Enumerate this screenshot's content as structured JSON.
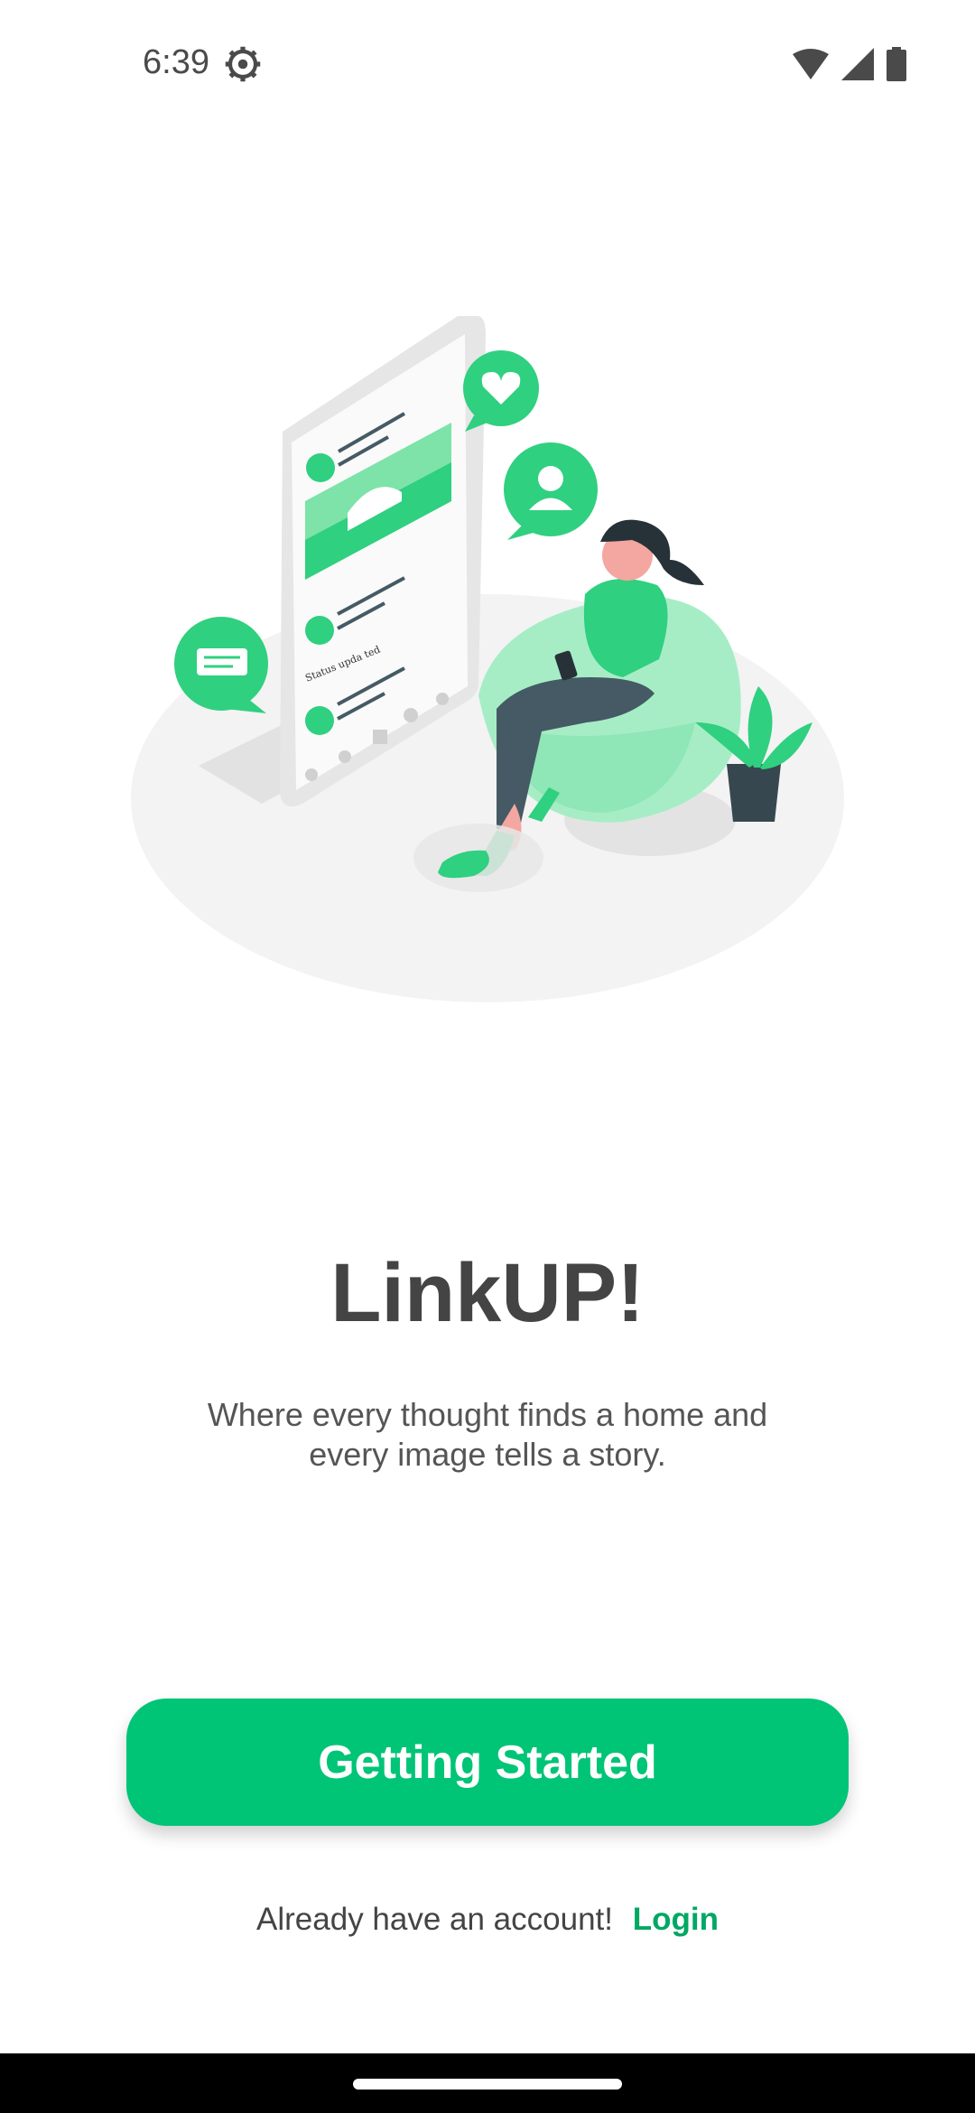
{
  "status_bar": {
    "time": "6:39",
    "icons": [
      "settings-gear-icon",
      "wifi-icon",
      "cell-signal-icon",
      "battery-icon"
    ]
  },
  "illustration": {
    "icon": "social-media-illustration",
    "post_caption": "Status upda    ted"
  },
  "welcome": {
    "title": "LinkUP!",
    "tagline_line1": "Where every thought finds a home and",
    "tagline_line2": "every image tells a story."
  },
  "actions": {
    "primary_label": "Getting Started",
    "login_prompt": "Already have an account!",
    "login_label": "Login"
  },
  "colors": {
    "accent": "#00c476",
    "accent_dark": "#00a862",
    "accent_light": "#a6edc6",
    "title": "#444444"
  }
}
